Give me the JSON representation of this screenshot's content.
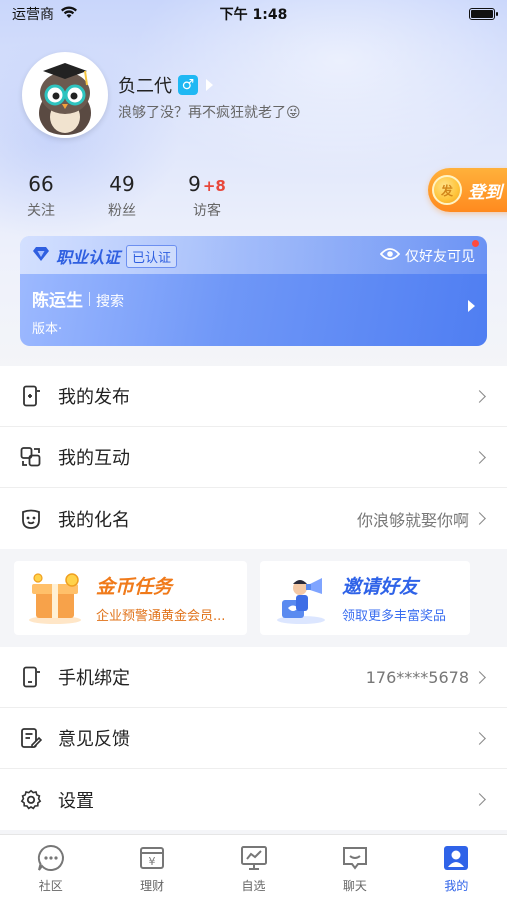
{
  "status_bar": {
    "carrier": "运营商",
    "time": "下午 1:48"
  },
  "profile": {
    "username": "负二代",
    "gender_symbol": "♂",
    "bio": "浪够了没？再不疯狂就老了😜"
  },
  "stats": [
    {
      "value": "66",
      "extra": "",
      "label": "关注"
    },
    {
      "value": "49",
      "extra": "",
      "label": "粉丝"
    },
    {
      "value": "9",
      "extra": "+8",
      "label": "访客"
    }
  ],
  "signin": {
    "coin_text": "发",
    "label": "登到"
  },
  "cert": {
    "title": "职业认证",
    "badge": "已认证",
    "visibility": "仅好友可见",
    "name": "陈运生",
    "role": "搜索",
    "version": "版本·"
  },
  "menu_group_1": [
    {
      "label": "我的发布",
      "value": "",
      "icon": "publish-icon"
    },
    {
      "label": "我的互动",
      "value": "",
      "icon": "interaction-icon"
    },
    {
      "label": "我的化名",
      "value": "你浪够就娶你啊",
      "icon": "mask-icon"
    }
  ],
  "promos": [
    {
      "title": "金币任务",
      "subtitle": "企业预警通黄金会员...",
      "title_color": "#f07a1a",
      "sub_color": "#e0731a"
    },
    {
      "title": "邀请好友",
      "subtitle": "领取更多丰富奖品",
      "title_color": "#2f63e8",
      "sub_color": "#3a6ef0"
    }
  ],
  "menu_group_2": [
    {
      "label": "手机绑定",
      "value": "176****5678",
      "icon": "phone-icon"
    },
    {
      "label": "意见反馈",
      "value": "",
      "icon": "feedback-icon"
    },
    {
      "label": "设置",
      "value": "",
      "icon": "settings-icon"
    }
  ],
  "tabs": [
    {
      "label": "社区",
      "icon": "community-icon",
      "active": false
    },
    {
      "label": "理财",
      "icon": "finance-icon",
      "active": false
    },
    {
      "label": "自选",
      "icon": "watchlist-icon",
      "active": false
    },
    {
      "label": "聊天",
      "icon": "chat-icon",
      "active": false
    },
    {
      "label": "我的",
      "icon": "profile-icon",
      "active": true
    }
  ],
  "colors": {
    "accent": "#2f63e8",
    "gender": "#1fb8f3",
    "visitor_plus": "#e8473b",
    "signin": "#ff8a1f"
  }
}
